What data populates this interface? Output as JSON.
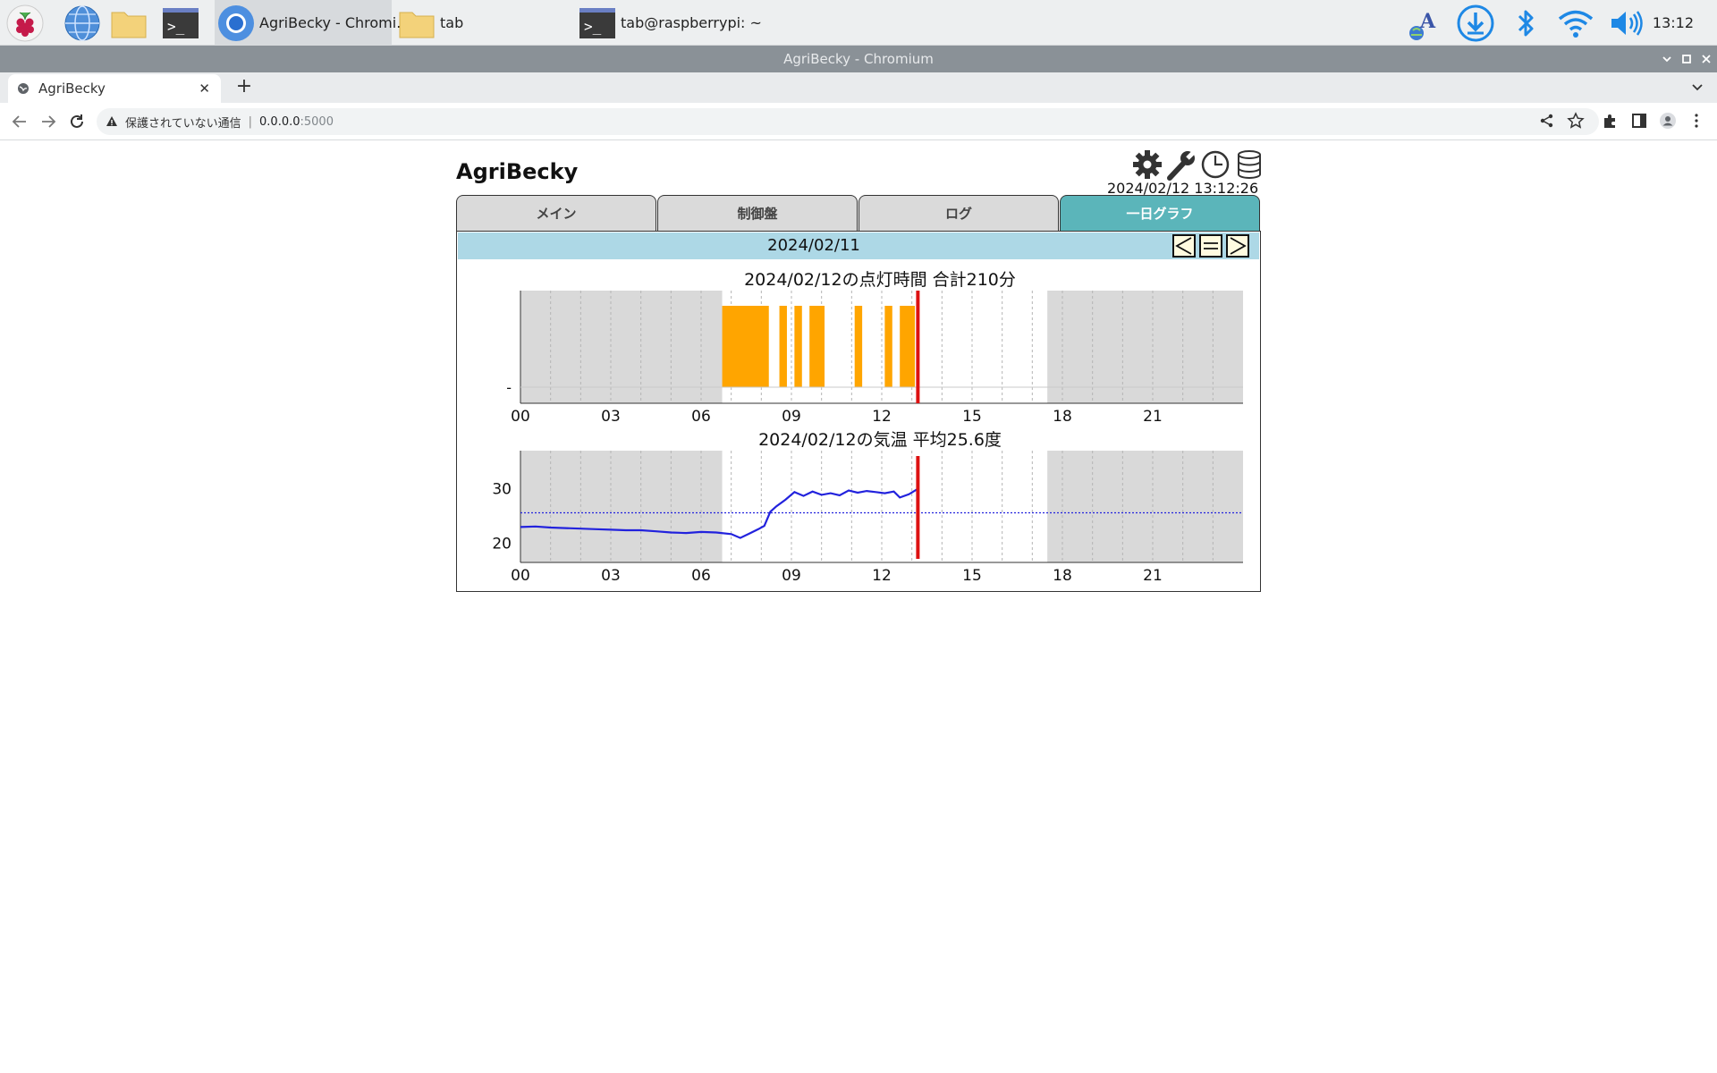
{
  "taskbar": {
    "tasks": [
      {
        "label": "AgriBecky - Chromi..."
      },
      {
        "label": "tab"
      },
      {
        "label": "tab@raspberrypi: ~"
      }
    ],
    "clock": "13:12"
  },
  "window": {
    "title": "AgriBecky - Chromium"
  },
  "browser": {
    "tab_title": "AgriBecky",
    "security_label": "保護されていない通信",
    "url_host": "0.0.0.0",
    "url_port": ":5000"
  },
  "app": {
    "title": "AgriBecky",
    "datetime": "2024/02/12 13:12:26",
    "tabs": [
      {
        "label": "メイン"
      },
      {
        "label": "制御盤"
      },
      {
        "label": "ログ"
      },
      {
        "label": "一日グラフ"
      }
    ],
    "selected_tab": 3,
    "date": "2024/02/11",
    "nav_prev": "<",
    "nav_today": "=",
    "nav_next": ">"
  },
  "colors": {
    "selected_tab": "#5bb5ba",
    "date_bar": "#add8e6",
    "light_bar": "#ffa500",
    "temp_line": "#2222dd",
    "now_line": "#dd1111",
    "night_shade": "#d9d9d9"
  },
  "chart_data": [
    {
      "type": "bar",
      "title": "2024/02/12の点灯時間 合計210分",
      "x_unit": "hour",
      "xlim": [
        0,
        24
      ],
      "x_ticks": [
        "00",
        "03",
        "06",
        "09",
        "12",
        "15",
        "18",
        "21"
      ],
      "y_ticks": [
        "-"
      ],
      "night_periods": [
        [
          0,
          6.7
        ],
        [
          17.5,
          24
        ]
      ],
      "now": 13.2,
      "on_intervals": [
        [
          6.7,
          8.25
        ],
        [
          8.6,
          8.85
        ],
        [
          9.1,
          9.35
        ],
        [
          9.6,
          10.1
        ],
        [
          11.1,
          11.35
        ],
        [
          12.1,
          12.35
        ],
        [
          12.6,
          13.1
        ]
      ]
    },
    {
      "type": "line",
      "title": "2024/02/12の気温 平均25.6度",
      "x_unit": "hour",
      "xlim": [
        0,
        24
      ],
      "ylim": [
        16.5,
        37
      ],
      "x_ticks": [
        "00",
        "03",
        "06",
        "09",
        "12",
        "15",
        "18",
        "21"
      ],
      "y_ticks": [
        20,
        30
      ],
      "average": 25.6,
      "night_periods": [
        [
          0,
          6.7
        ],
        [
          17.5,
          24
        ]
      ],
      "now": 13.2,
      "series": [
        {
          "x": [
            0,
            0.5,
            1,
            1.5,
            2,
            2.5,
            3,
            3.5,
            4,
            4.5,
            5,
            5.5,
            6,
            6.5,
            7,
            7.3,
            7.6,
            7.9,
            8.1,
            8.3,
            8.5,
            8.8,
            9.1,
            9.4,
            9.7,
            10,
            10.3,
            10.6,
            10.9,
            11.2,
            11.5,
            11.8,
            12.1,
            12.4,
            12.6,
            12.9,
            13.2
          ],
          "y": [
            23.0,
            23.1,
            22.9,
            22.8,
            22.7,
            22.6,
            22.5,
            22.4,
            22.4,
            22.2,
            22.0,
            21.9,
            22.1,
            22.0,
            21.7,
            21.0,
            21.8,
            22.6,
            23.2,
            25.8,
            26.8,
            28.0,
            29.4,
            28.7,
            29.5,
            28.9,
            29.2,
            28.8,
            29.7,
            29.3,
            29.6,
            29.4,
            29.2,
            29.5,
            28.4,
            29.0,
            30.0
          ]
        }
      ]
    }
  ]
}
